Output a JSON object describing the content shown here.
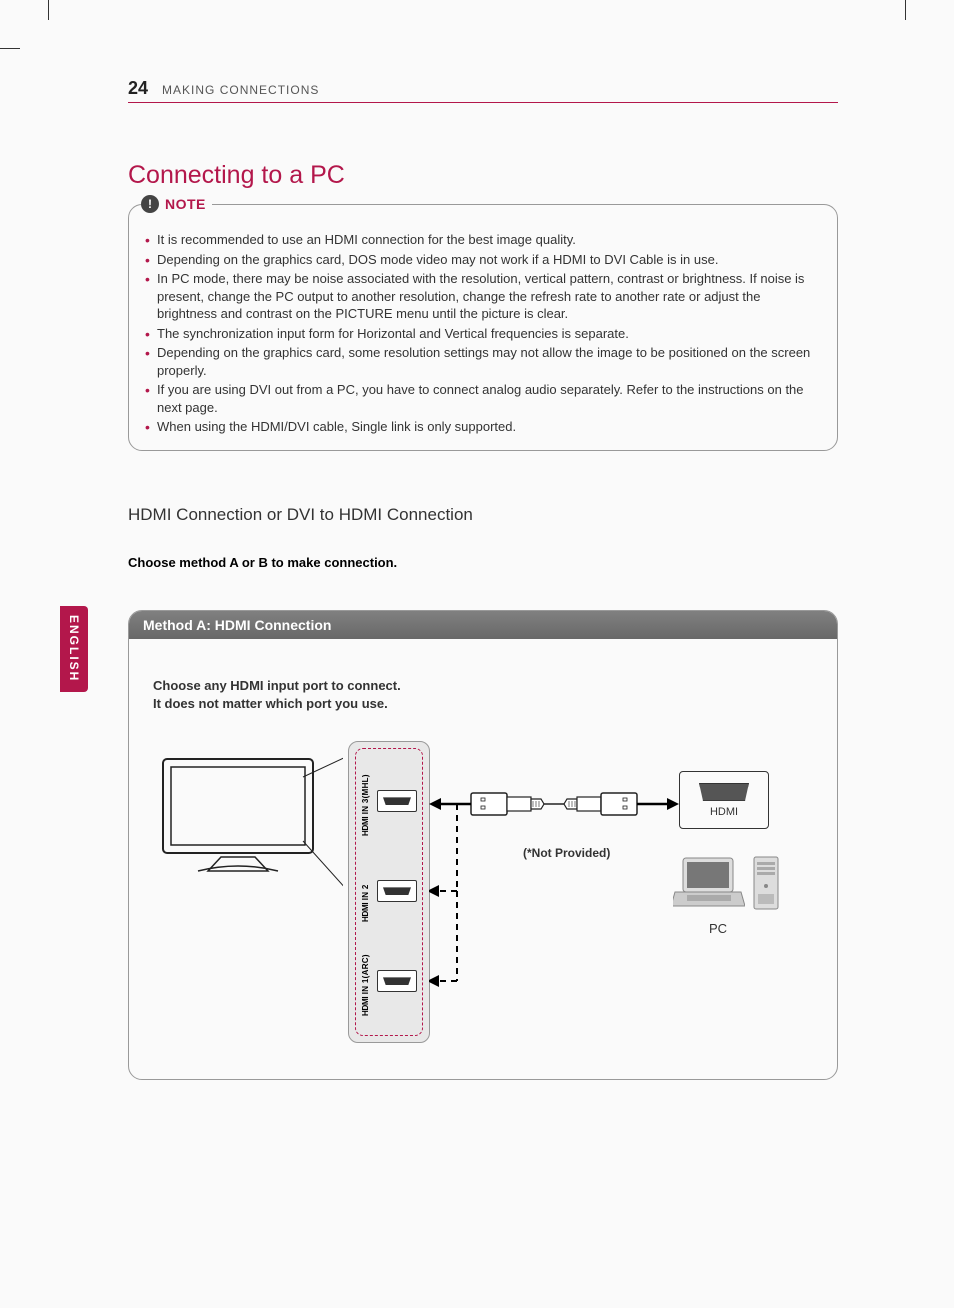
{
  "header": {
    "page_number": "24",
    "running_head": "MAKING CONNECTIONS"
  },
  "h1": "Connecting to a PC",
  "note": {
    "label": "NOTE",
    "items": [
      "It is recommended to use an HDMI connection for the best image quality.",
      "Depending on the graphics card, DOS mode video may not work if a HDMI to DVI Cable is in use.",
      "In PC mode, there may be noise associated with the resolution, vertical pattern, contrast or brightness. If noise is present, change the PC output to another resolution, change the refresh rate to another rate or adjust the brightness and contrast on the PICTURE menu until the picture is clear.",
      "The synchronization input form for Horizontal and Vertical frequencies is separate.",
      "Depending on the graphics card, some resolution settings may not allow the image to be positioned on the screen properly.",
      "If you are using DVI out from a PC, you have to connect analog audio separately. Refer to the instructions on the next page.",
      "When using the HDMI/DVI cable, Single link is only supported."
    ]
  },
  "h2": "HDMI Connection or DVI to HDMI Connection",
  "instruction": "Choose method A or B to make connection.",
  "method": {
    "title": "Method A: HDMI Connection",
    "desc_line1": "Choose any HDMI input port to connect.",
    "desc_line2": "It does not matter which port you use.",
    "port1": "IN 3(MHL)",
    "port2": "IN 2",
    "port3": "IN 1(ARC)",
    "hdmi_logo": "HDMI",
    "not_provided": "(*Not Provided)",
    "hdmi_out": "HDMI",
    "pc_label": "PC"
  },
  "lang_tab": "ENGLISH"
}
